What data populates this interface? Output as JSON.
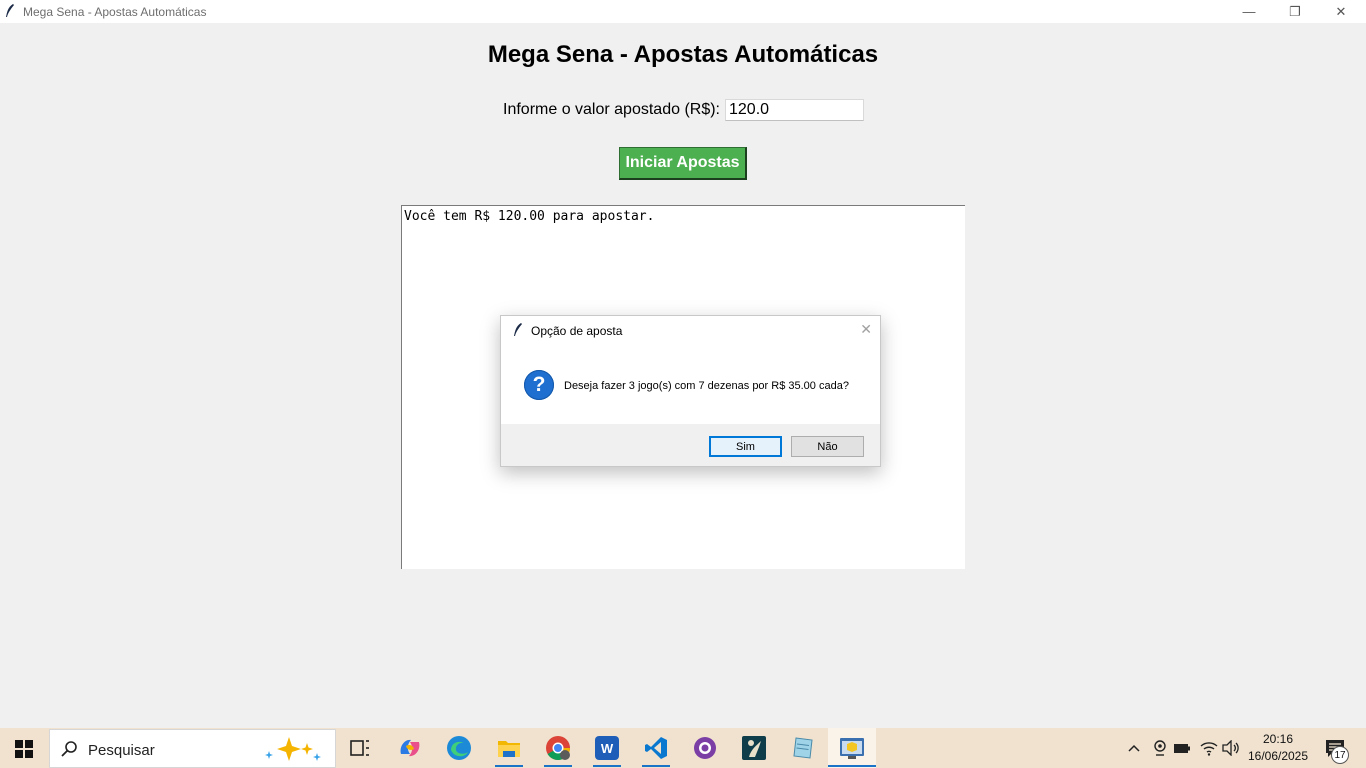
{
  "window": {
    "title": "Mega Sena - Apostas Automáticas",
    "controls": {
      "minimize": "—",
      "maximize": "❐",
      "close": "✕"
    }
  },
  "app": {
    "heading": "Mega Sena - Apostas Automáticas",
    "amount_label": "Informe o valor apostado (R$):",
    "amount_value": "120.0",
    "start_button": "Iniciar Apostas",
    "output_lines": [
      "Você tem R$ 120.00 para apostar."
    ]
  },
  "dialog": {
    "title": "Opção de aposta",
    "close": "✕",
    "icon": "question-icon",
    "icon_glyph": "?",
    "message": "Deseja fazer 3 jogo(s) com 7 dezenas por R$ 35.00 cada?",
    "yes_label": "Sim",
    "no_label": "Não"
  },
  "taskbar": {
    "search_placeholder": "Pesquisar",
    "apps": [
      {
        "name": "task-view-icon"
      },
      {
        "name": "copilot-icon"
      },
      {
        "name": "edge-icon"
      },
      {
        "name": "file-explorer-icon"
      },
      {
        "name": "chrome-icon"
      },
      {
        "name": "word-icon",
        "glyph": "W"
      },
      {
        "name": "vscode-icon"
      },
      {
        "name": "github-desktop-icon"
      },
      {
        "name": "kindle-icon"
      },
      {
        "name": "notepad-icon"
      },
      {
        "name": "python-tk-icon"
      }
    ],
    "tray": {
      "chevron": "^",
      "clock_time": "20:16",
      "clock_date": "16/06/2025",
      "notification_count": "17"
    }
  },
  "colors": {
    "start_button_bg": "#4caf50",
    "dialog_default_border": "#0078d7",
    "question_icon": "#1e6fd0",
    "taskbar_bg": "#f0e2cf"
  }
}
